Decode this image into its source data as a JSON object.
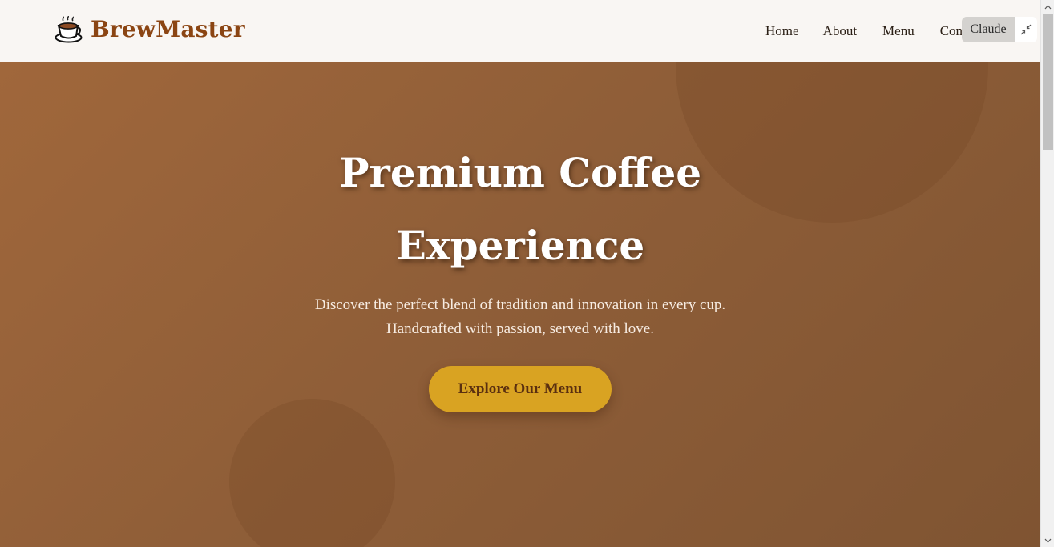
{
  "header": {
    "brand": "BrewMaster",
    "logo_icon": "coffee-cup-icon",
    "brand_color": "#8b4513",
    "nav": [
      {
        "label": "Home"
      },
      {
        "label": "About"
      },
      {
        "label": "Menu"
      },
      {
        "label": "Contact"
      }
    ]
  },
  "overlay": {
    "label": "Claude",
    "collapse_icon": "collapse-arrows-icon"
  },
  "hero": {
    "title": "Premium Coffee Experience",
    "subtitle": "Discover the perfect blend of tradition and innovation in every cup. Handcrafted with passion, served with love.",
    "cta_label": "Explore Our Menu",
    "cta_color": "#d9a322",
    "background_color": "#8f5e38"
  },
  "scrollbar": {
    "up_icon": "scroll-up-arrow-icon",
    "down_icon": "scroll-down-arrow-icon"
  }
}
